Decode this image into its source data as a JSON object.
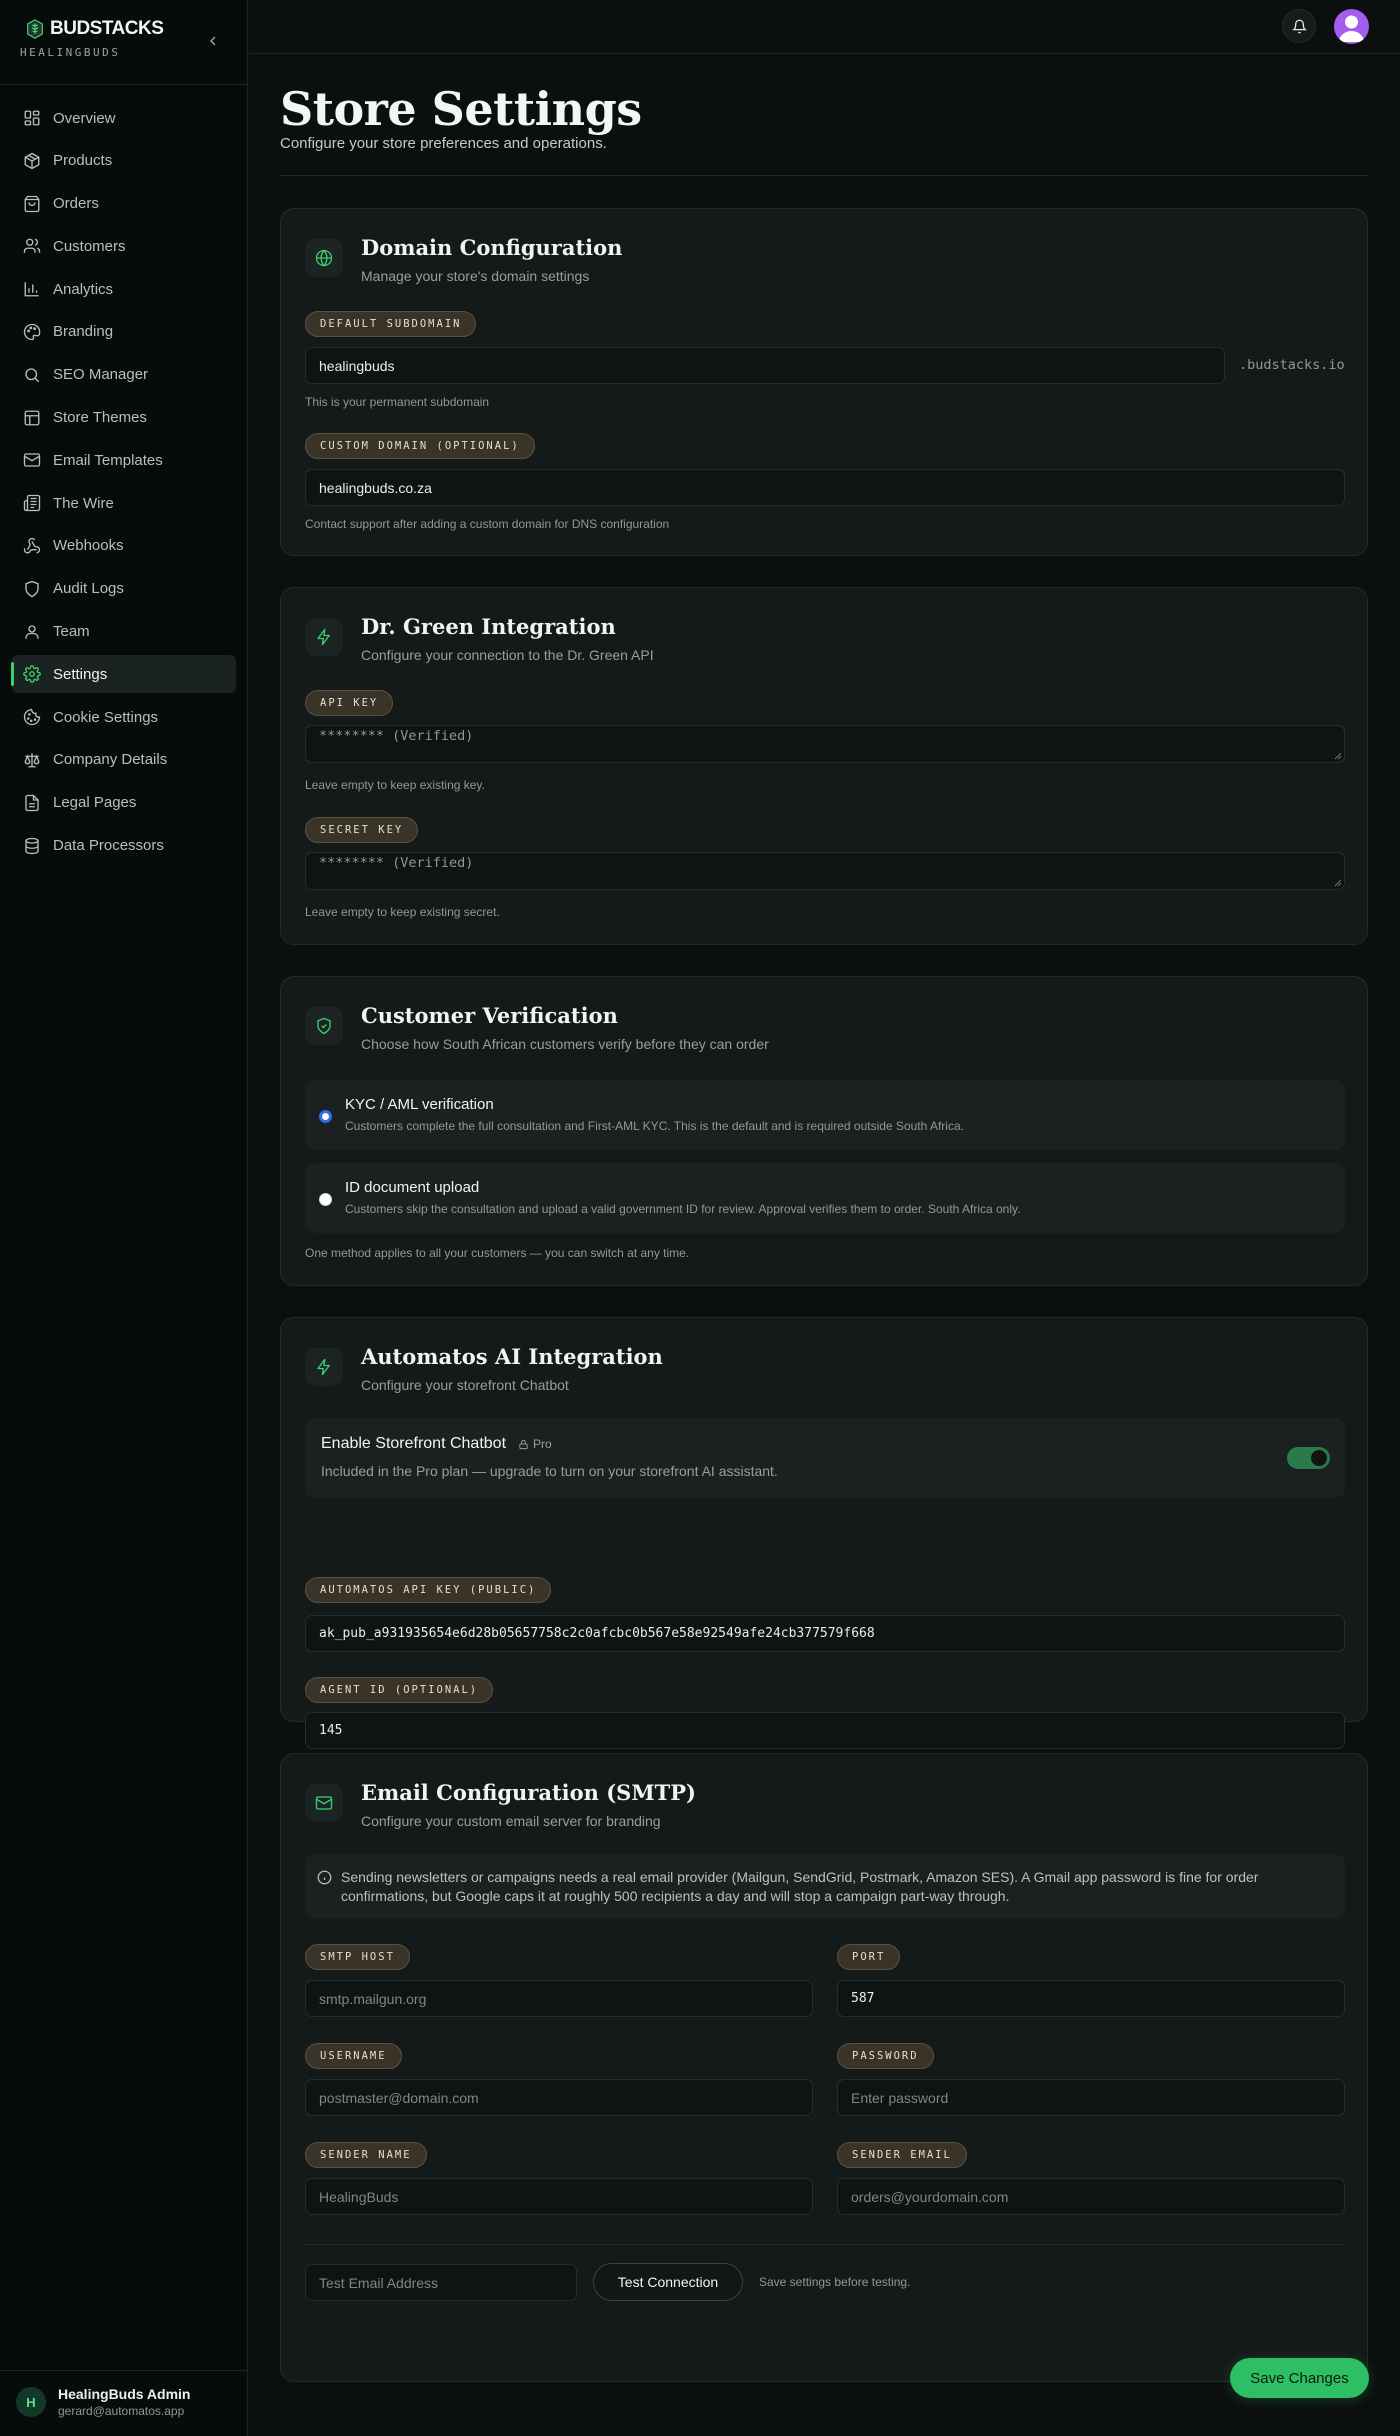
{
  "brand": {
    "name": "BUDSTACKS",
    "subtitle": "HEALINGBUDS"
  },
  "sidebar": {
    "items": [
      {
        "label": "Overview",
        "icon": "grid-icon"
      },
      {
        "label": "Products",
        "icon": "box-icon"
      },
      {
        "label": "Orders",
        "icon": "shopping-bag-icon"
      },
      {
        "label": "Customers",
        "icon": "users-icon"
      },
      {
        "label": "Analytics",
        "icon": "bar-chart-icon"
      },
      {
        "label": "Branding",
        "icon": "palette-icon"
      },
      {
        "label": "SEO Manager",
        "icon": "search-icon"
      },
      {
        "label": "Store Themes",
        "icon": "layout-icon"
      },
      {
        "label": "Email Templates",
        "icon": "mail-icon"
      },
      {
        "label": "The Wire",
        "icon": "newspaper-icon"
      },
      {
        "label": "Webhooks",
        "icon": "webhook-icon"
      },
      {
        "label": "Audit Logs",
        "icon": "shield-icon"
      },
      {
        "label": "Team",
        "icon": "user-icon"
      },
      {
        "label": "Settings",
        "icon": "gear-icon",
        "active": true
      },
      {
        "label": "Cookie Settings",
        "icon": "cookie-icon"
      },
      {
        "label": "Company Details",
        "icon": "scale-icon"
      },
      {
        "label": "Legal Pages",
        "icon": "file-icon"
      },
      {
        "label": "Data Processors",
        "icon": "database-icon"
      }
    ]
  },
  "user": {
    "initial": "H",
    "name": "HealingBuds Admin",
    "email": "gerard@automatos.app"
  },
  "page": {
    "title": "Store Settings",
    "subtitle": "Configure your store preferences and operations."
  },
  "domain": {
    "title": "Domain Configuration",
    "description": "Manage your store's domain settings",
    "subdomain_label": "DEFAULT SUBDOMAIN",
    "subdomain_value": "healingbuds",
    "subdomain_suffix": ".budstacks.io",
    "subdomain_hint": "This is your permanent subdomain",
    "custom_label": "CUSTOM DOMAIN (OPTIONAL)",
    "custom_value": "healingbuds.co.za",
    "custom_hint": "Contact support after adding a custom domain for DNS configuration"
  },
  "drgreen": {
    "title": "Dr. Green Integration",
    "description": "Configure your connection to the Dr. Green API",
    "api_label": "API KEY",
    "api_placeholder": "******** (Verified)",
    "api_hint": "Leave empty to keep existing key.",
    "secret_label": "SECRET KEY",
    "secret_placeholder": "******** (Verified)",
    "secret_hint": "Leave empty to keep existing secret."
  },
  "verification": {
    "title": "Customer Verification",
    "description": "Choose how South African customers verify before they can order",
    "options": [
      {
        "title": "KYC / AML verification",
        "description": "Customers complete the full consultation and First-AML KYC. This is the default and is required outside South Africa.",
        "checked": true
      },
      {
        "title": "ID document upload",
        "description": "Customers skip the consultation and upload a valid government ID for review. Approval verifies them to order. South Africa only.",
        "checked": false
      }
    ],
    "hint": "One method applies to all your customers — you can switch at any time."
  },
  "automatos": {
    "title": "Automatos AI Integration",
    "description": "Configure your storefront Chatbot",
    "chatbot_title": "Enable Storefront Chatbot",
    "chatbot_badge": "Pro",
    "chatbot_desc": "Included in the Pro plan — upgrade to turn on your storefront AI assistant.",
    "chatbot_enabled": true,
    "api_label": "AUTOMATOS API KEY (PUBLIC)",
    "api_value": "ak_pub_a931935654e6d28b05657758c2c0afcbc0b567e58e92549afe24cb377579f668",
    "agent_label": "AGENT ID (OPTIONAL)",
    "agent_value": "145"
  },
  "smtp": {
    "title": "Email Configuration (SMTP)",
    "description": "Configure your custom email server for branding",
    "info": "Sending newsletters or campaigns needs a real email provider (Mailgun, SendGrid, Postmark, Amazon SES). A Gmail app password is fine for order confirmations, but Google caps it at roughly 500 recipients a day and will stop a campaign part-way through.",
    "host_label": "SMTP HOST",
    "host_placeholder": "smtp.mailgun.org",
    "port_label": "PORT",
    "port_value": "587",
    "username_label": "USERNAME",
    "username_placeholder": "postmaster@domain.com",
    "password_label": "PASSWORD",
    "password_placeholder": "Enter password",
    "sender_name_label": "SENDER NAME",
    "sender_name_placeholder": "HealingBuds",
    "sender_email_label": "SENDER EMAIL",
    "sender_email_placeholder": "orders@yourdomain.com",
    "test_email_placeholder": "Test Email Address",
    "test_button": "Test Connection",
    "test_hint": "Save settings before testing."
  },
  "actions": {
    "save_label": "Save Changes"
  },
  "colors": {
    "accent": "#2ebe64",
    "background": "#0c0f0f",
    "card": "#141a1a",
    "pill": "#3a3328"
  }
}
